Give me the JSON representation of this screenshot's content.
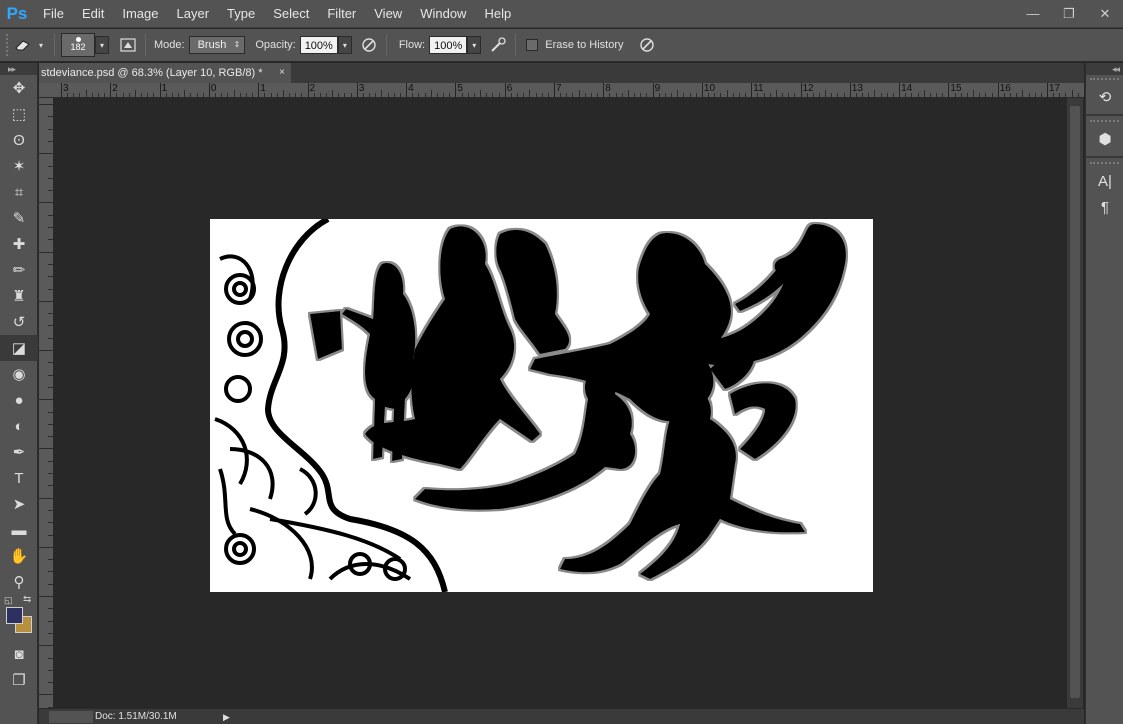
{
  "app": {
    "logo": "Ps",
    "menus": [
      "File",
      "Edit",
      "Image",
      "Layer",
      "Type",
      "Select",
      "Filter",
      "View",
      "Window",
      "Help"
    ],
    "window_controls": {
      "minimize": "—",
      "restore": "❐",
      "close": "✕"
    }
  },
  "options_bar": {
    "tool_icon": "eraser-icon",
    "brush_size": "182",
    "mode_label": "Mode:",
    "mode_value": "Brush",
    "opacity_label": "Opacity:",
    "opacity_value": "100%",
    "flow_label": "Flow:",
    "flow_value": "100%",
    "erase_history_label": "Erase to History",
    "erase_history_checked": false
  },
  "toolbar": {
    "collapse": "▸▸",
    "tools": [
      {
        "name": "move-tool",
        "glyph": "✥"
      },
      {
        "name": "marquee-tool",
        "glyph": "⬚"
      },
      {
        "name": "lasso-tool",
        "glyph": "ʘ"
      },
      {
        "name": "magic-wand-tool",
        "glyph": "✶"
      },
      {
        "name": "crop-tool",
        "glyph": "⌗"
      },
      {
        "name": "eyedropper-tool",
        "glyph": "✎"
      },
      {
        "name": "healing-brush-tool",
        "glyph": "✚"
      },
      {
        "name": "brush-tool",
        "glyph": "✏"
      },
      {
        "name": "clone-stamp-tool",
        "glyph": "♜"
      },
      {
        "name": "history-brush-tool",
        "glyph": "↺"
      },
      {
        "name": "eraser-tool",
        "glyph": "◪",
        "active": true
      },
      {
        "name": "paint-bucket-tool",
        "glyph": "◉"
      },
      {
        "name": "blur-tool",
        "glyph": "●"
      },
      {
        "name": "dodge-tool",
        "glyph": "◐"
      },
      {
        "name": "pen-tool",
        "glyph": "✒"
      },
      {
        "name": "type-tool",
        "glyph": "T"
      },
      {
        "name": "path-selection-tool",
        "glyph": "➤"
      },
      {
        "name": "rectangle-tool",
        "glyph": "▬"
      },
      {
        "name": "hand-tool",
        "glyph": "✋"
      },
      {
        "name": "zoom-tool",
        "glyph": "⚲"
      }
    ],
    "foreground_color": "#2c3162",
    "background_color": "#b8903d"
  },
  "document": {
    "tab_title": "stdeviance.psd @ 68.3% (Layer 10, RGB/8) *",
    "tab_close": "×",
    "ruler_labels": [
      "3",
      "2",
      "1",
      "0",
      "1",
      "2",
      "3",
      "4",
      "5",
      "6",
      "7",
      "8",
      "9",
      "10",
      "11",
      "12",
      "13",
      "14",
      "15",
      "16",
      "17"
    ],
    "status_doc_size": "Doc: 1.51M/30.1M",
    "status_arrow": "▶"
  },
  "right_dock": {
    "collapse": "◂◂",
    "buttons": [
      {
        "name": "history-panel-icon",
        "glyph": "⟲"
      },
      {
        "name": "3d-panel-icon",
        "glyph": "⬢"
      },
      {
        "name": "character-panel-icon",
        "glyph": "A|"
      },
      {
        "name": "paragraph-panel-icon",
        "glyph": "¶"
      }
    ]
  }
}
